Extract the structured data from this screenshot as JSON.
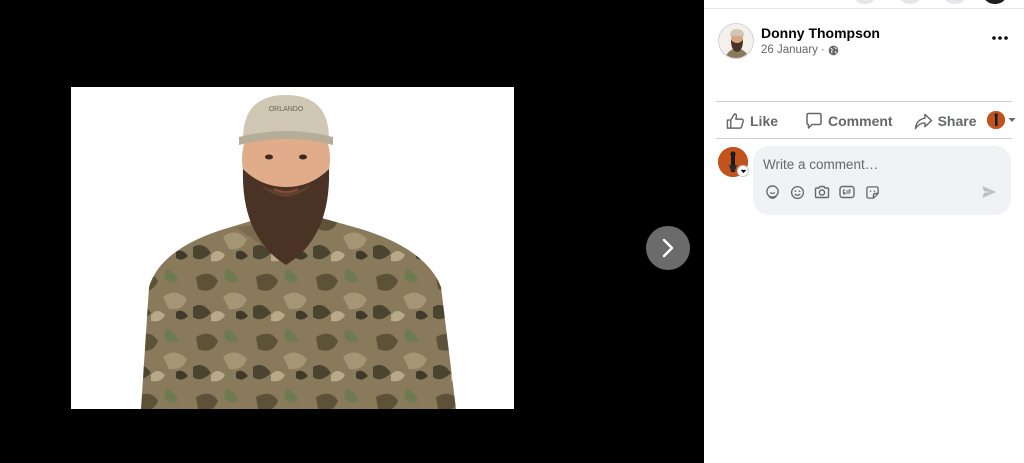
{
  "post": {
    "author": "Donny Thompson",
    "date": "26 January",
    "date_separator": "·",
    "privacy_icon": "globe-icon",
    "more_icon": "more-options-icon"
  },
  "photo": {
    "cap_text": "ORLANDO"
  },
  "viewer": {
    "next_icon": "chevron-right-icon"
  },
  "actions": [
    {
      "label": "Like",
      "icon": "thumbs-up-icon"
    },
    {
      "label": "Comment",
      "icon": "comment-icon"
    },
    {
      "label": "Share",
      "icon": "share-icon"
    }
  ],
  "comment": {
    "placeholder": "Write a comment…",
    "tools": [
      "avatar-sticker-icon",
      "emoji-icon",
      "camera-icon",
      "gif-icon",
      "sticker-icon"
    ],
    "send_icon": "send-icon"
  },
  "colors": {
    "text_primary": "#050505",
    "text_secondary": "#65676b",
    "input_bg": "#f0f2f5",
    "divider": "#ced0d4",
    "viewer_bg": "#000000",
    "nav_button": "#6b6b6b"
  }
}
